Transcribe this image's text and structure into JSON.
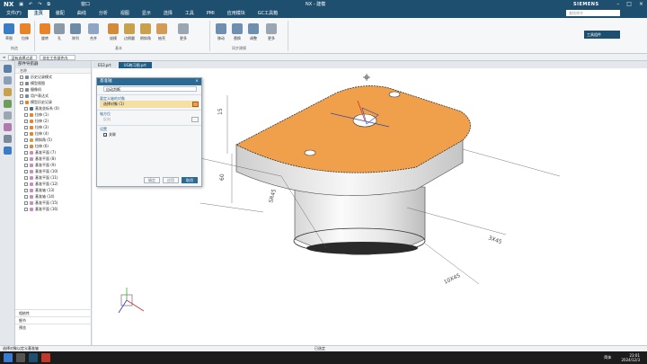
{
  "titlebar": {
    "logo": "NX",
    "window_menu": "窗口",
    "title": "NX - 建模",
    "brand": "SIEMENS"
  },
  "menubar": {
    "items": [
      "文件(F)",
      "主页",
      "装配",
      "曲线",
      "分析",
      "视图",
      "显示",
      "选择",
      "工具",
      "PMI",
      "应用模块",
      "GC工具箱"
    ],
    "active_index": 1,
    "search_placeholder": "查找命令"
  },
  "ribbon": {
    "buttons": [
      {
        "label": "草图",
        "color": "#3b7dc4"
      },
      {
        "label": "拉伸",
        "color": "#e8832a"
      },
      {
        "label": "旋转",
        "color": "#e8832a"
      },
      {
        "label": "孔",
        "color": "#8a9aa8"
      },
      {
        "label": "阵列",
        "color": "#6d8aa6"
      },
      {
        "label": "合并",
        "color": "#8ea6c4"
      },
      {
        "label": "拔模",
        "color": "#d18b3a"
      },
      {
        "label": "边倒圆",
        "color": "#c9a04b"
      },
      {
        "label": "倒斜角",
        "color": "#c9a04b"
      },
      {
        "label": "抽壳",
        "color": "#d39b55"
      },
      {
        "label": "更多",
        "color": "#9aa6b2"
      },
      {
        "label": "移动",
        "color": "#6f8fb0"
      },
      {
        "label": "替换",
        "color": "#6f8fb0"
      },
      {
        "label": "调整",
        "color": "#6f8fb0"
      },
      {
        "label": "更多",
        "color": "#9aa6b2"
      }
    ],
    "groups": [
      "构造",
      "基本",
      "同步建模"
    ],
    "right_panel": "工具组件"
  },
  "selection_bar": {
    "filter": "没有选择过滤器",
    "scope": "仅在工作部件内"
  },
  "navigator": {
    "header": "部件导航器",
    "column": "名称",
    "rows": [
      {
        "label": "历史记录模式",
        "indent": 1,
        "color": "#7a8a9a"
      },
      {
        "label": "模型视图",
        "indent": 1,
        "color": "#7a8a9a"
      },
      {
        "label": "摄像机",
        "indent": 1,
        "color": "#7a8a9a"
      },
      {
        "label": "用户表达式",
        "indent": 1,
        "color": "#7a8a9a"
      },
      {
        "label": "模型历史记录",
        "indent": 1,
        "color": "#e8832a"
      },
      {
        "label": "基准坐标系 (0)",
        "indent": 2,
        "color": "#4a6a8a"
      },
      {
        "label": "拉伸 (1)",
        "indent": 2,
        "color": "#e8832a"
      },
      {
        "label": "拉伸 (2)",
        "indent": 2,
        "color": "#e8832a"
      },
      {
        "label": "拉伸 (3)",
        "indent": 2,
        "color": "#e8832a"
      },
      {
        "label": "拉伸 (4)",
        "indent": 2,
        "color": "#e8832a"
      },
      {
        "label": "倒斜角 (5)",
        "indent": 2,
        "color": "#c9a04b"
      },
      {
        "label": "拉伸 (6)",
        "indent": 2,
        "color": "#e8832a"
      },
      {
        "label": "基准平面 (7)",
        "indent": 2,
        "color": "#c58fc0"
      },
      {
        "label": "基准平面 (8)",
        "indent": 2,
        "color": "#c58fc0"
      },
      {
        "label": "基准平面 (9)",
        "indent": 2,
        "color": "#c58fc0"
      },
      {
        "label": "基准平面 (10)",
        "indent": 2,
        "color": "#c58fc0"
      },
      {
        "label": "基准平面 (11)",
        "indent": 2,
        "color": "#c58fc0"
      },
      {
        "label": "基准平面 (12)",
        "indent": 2,
        "color": "#c58fc0"
      },
      {
        "label": "基准轴 (13)",
        "indent": 2,
        "color": "#c58fc0"
      },
      {
        "label": "基准轴 (14)",
        "indent": 2,
        "color": "#c58fc0"
      },
      {
        "label": "基准平面 (15)",
        "indent": 2,
        "color": "#c58fc0"
      },
      {
        "label": "基准平面 (16)",
        "indent": 2,
        "color": "#c58fc0"
      }
    ],
    "footer": [
      "相依性",
      "细节",
      "预览"
    ]
  },
  "tabs": [
    "ES3.prt",
    "UG练习图.prt"
  ],
  "active_tab": 1,
  "dialog": {
    "title": "基准轴",
    "type_value": "自动判断",
    "section_objects": "要定义轴的对象",
    "select_objects": "选择对象 (1)",
    "section_axis": "轴方位",
    "reverse_label": "反向",
    "section_settings": "设置",
    "associative": "关联",
    "buttons": {
      "apply_preview": "确定",
      "apply": "应用",
      "cancel": "取消"
    }
  },
  "dimensions": [
    "15",
    "60",
    "SR45",
    "3X45",
    "10X45"
  ],
  "status": {
    "left": "选择对象以定义基准轴",
    "center": "已选定"
  },
  "taskbar": {
    "time": "23:01",
    "date": "2024/12/3",
    "ime": "简体"
  },
  "colors": {
    "accent": "#1f4f6e",
    "face_orange": "#f0a04a",
    "dialog_title": "#2a6a94"
  }
}
